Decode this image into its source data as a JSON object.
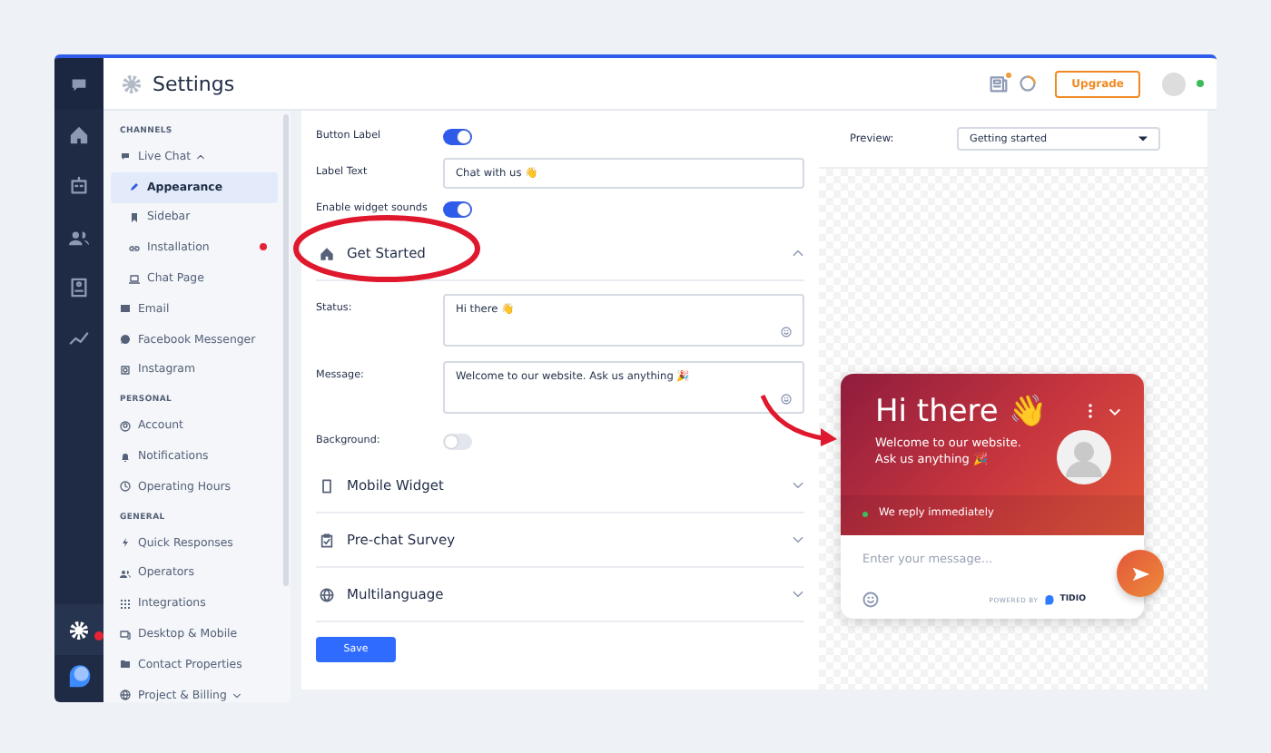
{
  "header": {
    "title": "Settings",
    "upgrade": "Upgrade",
    "online": true
  },
  "rail": [
    {
      "selected": false,
      "alert": false
    },
    {
      "selected": false,
      "alert": false
    },
    {
      "selected": false,
      "alert": false
    },
    {
      "selected": false,
      "alert": false
    },
    {
      "selected": false,
      "alert": false
    },
    {
      "selected": true,
      "alert": true
    }
  ],
  "sidebar": [
    {
      "heading": "CHANNELS",
      "items": [
        {
          "label": "Live Chat",
          "selected": false,
          "expanded": true,
          "children": [
            {
              "label": "Appearance",
              "selected": true,
              "alert": false
            },
            {
              "label": "Sidebar",
              "selected": false,
              "alert": false
            },
            {
              "label": "Installation",
              "selected": false,
              "alert": true
            },
            {
              "label": "Chat Page",
              "selected": false,
              "alert": false
            }
          ]
        },
        {
          "label": "Email",
          "selected": false
        },
        {
          "label": "Facebook Messenger",
          "selected": false
        },
        {
          "label": "Instagram",
          "selected": false
        }
      ]
    },
    {
      "heading": "PERSONAL",
      "items": [
        {
          "label": "Account",
          "selected": false
        },
        {
          "label": "Notifications",
          "selected": false
        },
        {
          "label": "Operating Hours",
          "selected": false
        }
      ]
    },
    {
      "heading": "GENERAL",
      "items": [
        {
          "label": "Quick Responses",
          "selected": false
        },
        {
          "label": "Operators",
          "selected": false
        },
        {
          "label": "Integrations",
          "selected": false
        },
        {
          "label": "Desktop & Mobile",
          "selected": false
        },
        {
          "label": "Contact Properties",
          "selected": false
        },
        {
          "label": "Project & Billing",
          "selected": false,
          "expanded": false
        }
      ]
    }
  ],
  "fields": [
    {
      "kind": "toggle",
      "label": "Button Label",
      "on": true
    },
    {
      "kind": "text",
      "label": "Label Text",
      "value": "Chat with us 👋"
    },
    {
      "kind": "toggle",
      "label": "Enable widget sounds",
      "on": true
    }
  ],
  "sections": [
    {
      "title": "Get Started",
      "expanded": true,
      "fields": [
        {
          "kind": "textarea",
          "label": "Status:",
          "value": "Hi there 👋"
        },
        {
          "kind": "textarea",
          "label": "Message:",
          "value": "Welcome to our website. Ask us anything 🎉"
        },
        {
          "kind": "toggle",
          "label": "Background:",
          "on": false
        }
      ]
    },
    {
      "title": "Mobile Widget",
      "expanded": false
    },
    {
      "title": "Pre-chat Survey",
      "expanded": false
    },
    {
      "title": "Multilanguage",
      "expanded": false
    }
  ],
  "save": "Save",
  "preview": {
    "label": "Preview:",
    "value": "Getting started"
  },
  "widget": {
    "title": "Hi there 👋",
    "message": [
      "Welcome to our website.",
      "Ask us anything 🎉"
    ],
    "status": "We reply immediately",
    "placeholder": "Enter your message...",
    "powered": "POWERED BY",
    "brand": "TIDIO"
  }
}
